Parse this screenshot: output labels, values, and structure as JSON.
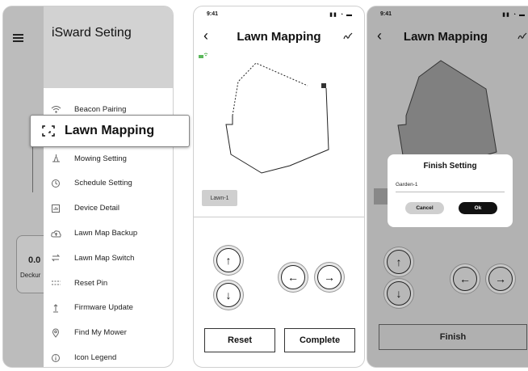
{
  "panel1": {
    "drawer_title": "iSward Seting",
    "menu_items": [
      {
        "label": "Beacon Pairing",
        "icon": "wifi-beacon-icon"
      },
      {
        "label": "Mowing Setting",
        "icon": "mower-blade-icon"
      },
      {
        "label": "Schedule Setting",
        "icon": "clock-icon"
      },
      {
        "label": "Device Detail",
        "icon": "chart-icon"
      },
      {
        "label": "Lawn Map Backup",
        "icon": "cloud-icon"
      },
      {
        "label": "Lawn Map Switch",
        "icon": "swap-icon"
      },
      {
        "label": "Reset Pin",
        "icon": "pin-dots-icon"
      },
      {
        "label": "Firmware Update",
        "icon": "update-icon"
      },
      {
        "label": "Find My Mower",
        "icon": "location-icon"
      },
      {
        "label": "Icon Legend",
        "icon": "info-icon"
      }
    ],
    "highlighted_item": "Lawn Mapping",
    "card_value": "0.0",
    "card_label": "Deckur"
  },
  "panel2": {
    "time": "9:41",
    "title": "Lawn Mapping",
    "lawn_chip": "Lawn-1",
    "reset_label": "Reset",
    "complete_label": "Complete"
  },
  "panel3": {
    "time": "9:41",
    "title": "Lawn Mapping",
    "dialog_title": "Finish Setting",
    "garden_name": "Garden-1",
    "cancel_label": "Cancel",
    "ok_label": "Ok",
    "finish_label": "Finish"
  }
}
